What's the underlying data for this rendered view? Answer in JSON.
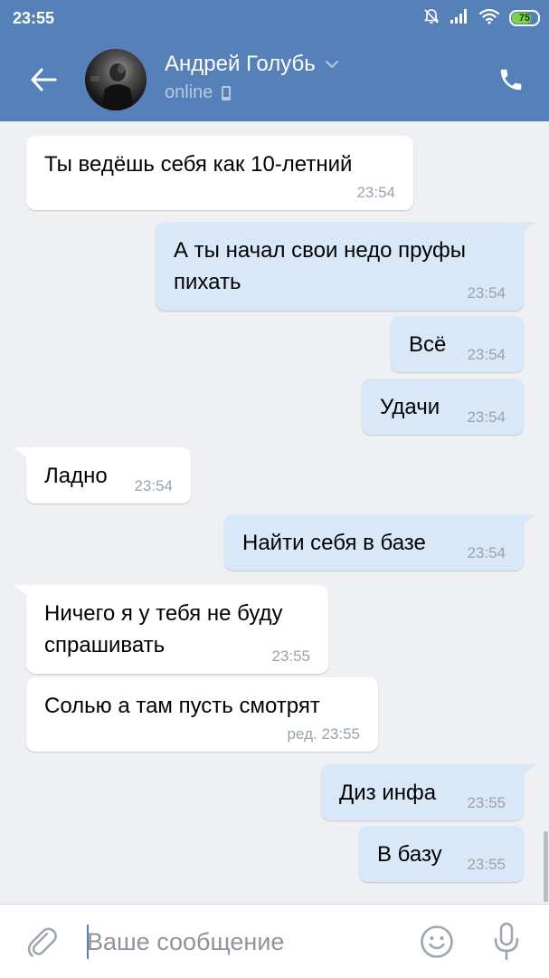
{
  "status_bar": {
    "time": "23:55",
    "battery": "75",
    "icons": [
      "alarm-off-icon",
      "signal-icon",
      "wifi-icon",
      "battery-icon"
    ]
  },
  "header": {
    "contact_name": "Андрей Голубь",
    "status": "online",
    "icons": [
      "back-arrow-icon",
      "chevron-down-icon",
      "mobile-icon",
      "phone-icon"
    ]
  },
  "messages": [
    {
      "direction": "in",
      "text_lines": [
        "Ты ведёшь себя как 10-летний"
      ],
      "time": "23:54",
      "tail": false
    },
    {
      "direction": "out",
      "text_lines": [
        "А ты начал свои недо пруфы",
        "пихать"
      ],
      "time": "23:54",
      "tail": true
    },
    {
      "direction": "out",
      "text_lines": [
        "Всё"
      ],
      "time": "23:54",
      "tail": false
    },
    {
      "direction": "out",
      "text_lines": [
        "Удачи"
      ],
      "time": "23:54",
      "tail": false
    },
    {
      "direction": "in",
      "text_lines": [
        "Ладно"
      ],
      "time": "23:54",
      "tail": true
    },
    {
      "direction": "out",
      "text_lines": [
        "Найти себя в базе"
      ],
      "time": "23:54",
      "tail": true
    },
    {
      "direction": "in",
      "text_lines": [
        "Ничего я у тебя не буду",
        "спрашивать"
      ],
      "time": "23:55",
      "tail": true
    },
    {
      "direction": "in",
      "text_lines": [
        "Солью а там пусть смотрят"
      ],
      "time": "ред. 23:55",
      "tail": false
    },
    {
      "direction": "out",
      "text_lines": [
        "Диз инфа"
      ],
      "time": "23:55",
      "tail": true
    },
    {
      "direction": "out",
      "text_lines": [
        "В базу"
      ],
      "time": "23:55",
      "tail": false
    }
  ],
  "input": {
    "placeholder": "Ваше сообщение",
    "value": "",
    "icons": [
      "paperclip-icon",
      "emoji-icon",
      "microphone-icon"
    ]
  },
  "colors": {
    "header_bg": "#5680b8",
    "chat_bg": "#eef0f3",
    "incoming_bubble": "#ffffff",
    "outgoing_bubble": "#d9e8f8",
    "battery_fill": "#79d24b"
  }
}
